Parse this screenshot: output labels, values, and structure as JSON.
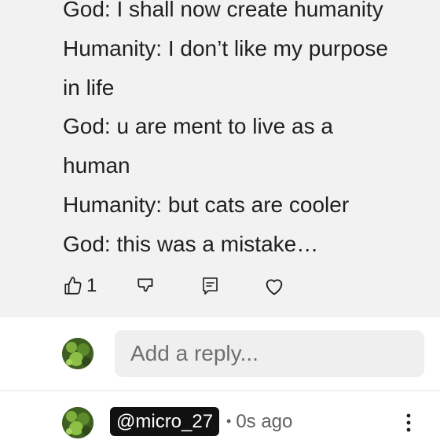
{
  "comment": {
    "lines": [
      "God: I shall now create humanity",
      "Humanity: I don’t like my purpose",
      "in life",
      "God: u are ment to live as a",
      "human",
      "Humanity: but cats are cooler",
      "God: this was a mistake…"
    ],
    "like_count": "1"
  },
  "icons": {
    "like": "thumbs-up-icon",
    "dislike": "thumbs-down-icon",
    "reply": "reply-icon",
    "heart": "heart-icon",
    "more": "more-vertical-icon"
  },
  "reply_input": {
    "placeholder": "Add a reply..."
  },
  "next_comment": {
    "username": "@micro_27",
    "separator": "•",
    "time": "0s ago"
  },
  "colors": {
    "card_bg": "#f2f2f2",
    "chip_bg": "#111111",
    "text": "#1f1f1f"
  }
}
